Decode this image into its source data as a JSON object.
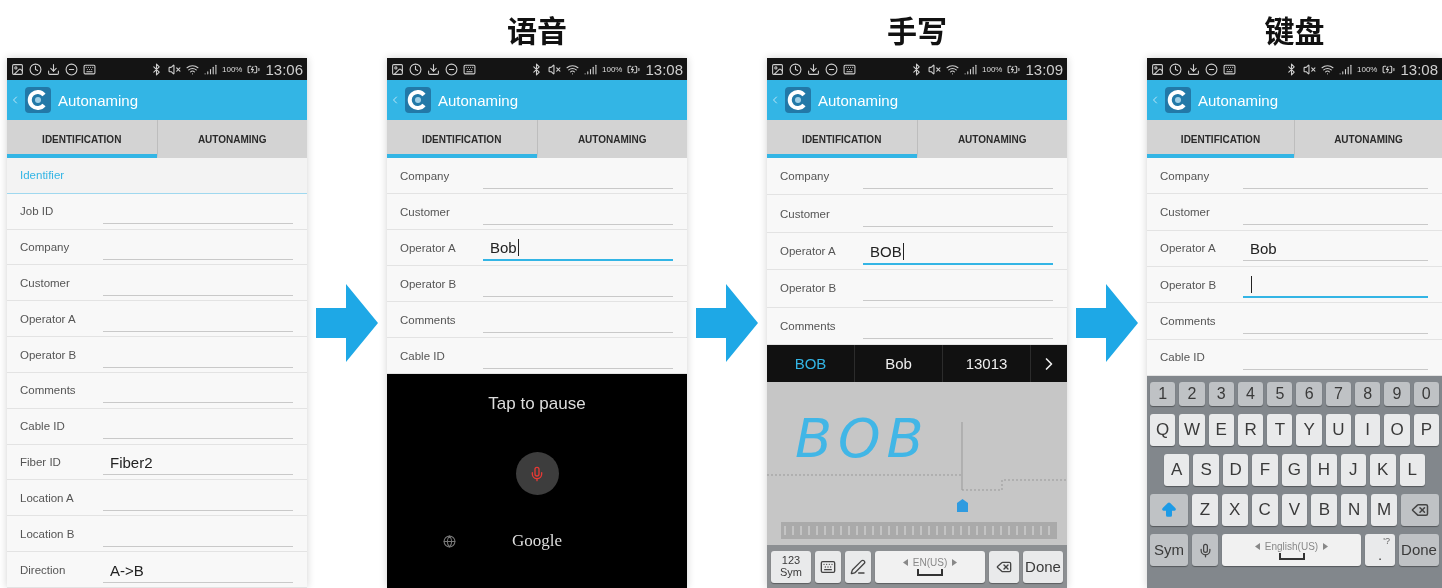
{
  "phones": [
    {
      "status_bar": {
        "battery": "100%",
        "time": "13:06"
      },
      "app_bar": {
        "title": "Autonaming"
      },
      "tabs": [
        {
          "label": "IDENTIFICATION",
          "selected": true
        },
        {
          "label": "AUTONAMING",
          "selected": false
        }
      ],
      "form": [
        {
          "kind": "section",
          "label": "Identifier"
        },
        {
          "kind": "field",
          "label": "Job ID",
          "focused": false
        },
        {
          "kind": "field",
          "label": "Company",
          "focused": false
        },
        {
          "kind": "field",
          "label": "Customer",
          "focused": false
        },
        {
          "kind": "field",
          "label": "Operator A",
          "focused": false
        },
        {
          "kind": "field",
          "label": "Operator B",
          "focused": false
        },
        {
          "kind": "field",
          "label": "Comments",
          "focused": false
        },
        {
          "kind": "field",
          "label": "Cable ID",
          "focused": false
        },
        {
          "kind": "field",
          "label": "Fiber ID",
          "value": "Fiber2",
          "focused": false
        },
        {
          "kind": "field",
          "label": "Location A",
          "focused": false
        },
        {
          "kind": "field",
          "label": "Location B",
          "focused": false
        },
        {
          "kind": "field",
          "label": "Direction",
          "value": "A->B",
          "focused": false
        }
      ]
    },
    {
      "heading": "语音",
      "status_bar": {
        "battery": "100%",
        "time": "13:08"
      },
      "app_bar": {
        "title": "Autonaming"
      },
      "tabs": [
        {
          "label": "IDENTIFICATION",
          "selected": true
        },
        {
          "label": "AUTONAMING",
          "selected": false
        }
      ],
      "form": [
        {
          "kind": "field",
          "label": "Company",
          "focused": false
        },
        {
          "kind": "field",
          "label": "Customer",
          "focused": false
        },
        {
          "kind": "field",
          "label": "Operator A",
          "value": "Bob",
          "focused": true
        },
        {
          "kind": "field",
          "label": "Operator B",
          "focused": false
        },
        {
          "kind": "field",
          "label": "Comments",
          "focused": false
        },
        {
          "kind": "field",
          "label": "Cable ID",
          "focused": false
        }
      ],
      "input_panel": {
        "kind": "voice",
        "prompt": "Tap to pause",
        "brand": "Google"
      }
    },
    {
      "heading": "手写",
      "status_bar": {
        "battery": "100%",
        "time": "13:09"
      },
      "app_bar": {
        "title": "Autonaming"
      },
      "tabs": [
        {
          "label": "IDENTIFICATION",
          "selected": true
        },
        {
          "label": "AUTONAMING",
          "selected": false
        }
      ],
      "form": [
        {
          "kind": "field",
          "label": "Company",
          "focused": false
        },
        {
          "kind": "field",
          "label": "Customer",
          "focused": false
        },
        {
          "kind": "field",
          "label": "Operator A",
          "value": "BOB",
          "focused": true
        },
        {
          "kind": "field",
          "label": "Operator B",
          "focused": false
        },
        {
          "kind": "field",
          "label": "Comments",
          "focused": false
        }
      ],
      "input_panel": {
        "kind": "handwriting",
        "candidates": [
          {
            "text": "BOB",
            "selected": true
          },
          {
            "text": "Bob",
            "selected": false
          },
          {
            "text": "13013",
            "selected": false
          }
        ],
        "ink": "BOB",
        "sym": "123\nSym",
        "space": "EN(US)",
        "done": "Done"
      }
    },
    {
      "heading": "键盘",
      "status_bar": {
        "battery": "100%",
        "time": "13:08"
      },
      "app_bar": {
        "title": "Autonaming"
      },
      "tabs": [
        {
          "label": "IDENTIFICATION",
          "selected": true
        },
        {
          "label": "AUTONAMING",
          "selected": false
        }
      ],
      "form": [
        {
          "kind": "field",
          "label": "Company",
          "focused": false
        },
        {
          "kind": "field",
          "label": "Customer",
          "focused": false
        },
        {
          "kind": "field",
          "label": "Operator A",
          "value": "Bob",
          "focused": false
        },
        {
          "kind": "field",
          "label": "Operator B",
          "focused": true
        },
        {
          "kind": "field",
          "label": "Comments",
          "focused": false
        },
        {
          "kind": "field",
          "label": "Cable ID",
          "focused": false
        }
      ],
      "input_panel": {
        "kind": "keyboard",
        "rows": [
          {
            "kind": "number",
            "keys": [
              "1",
              "2",
              "3",
              "4",
              "5",
              "6",
              "7",
              "8",
              "9",
              "0"
            ]
          },
          {
            "kind": "letter",
            "keys": [
              "Q",
              "W",
              "E",
              "R",
              "T",
              "Y",
              "U",
              "I",
              "O",
              "P"
            ]
          },
          {
            "kind": "letter",
            "keys": [
              "A",
              "S",
              "D",
              "F",
              "G",
              "H",
              "J",
              "K",
              "L"
            ]
          },
          {
            "kind": "shift",
            "keys": [
              "Z",
              "X",
              "C",
              "V",
              "B",
              "N",
              "M"
            ]
          }
        ],
        "shift_on": true,
        "sym": "Sym",
        "space": "English(US)",
        "punct_hint": "'?",
        "punct": ".",
        "done": "Done"
      }
    }
  ]
}
